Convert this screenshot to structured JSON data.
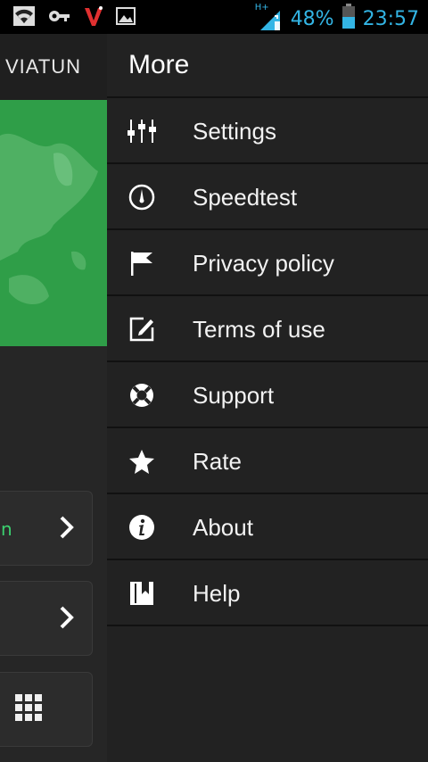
{
  "status_bar": {
    "battery": "48%",
    "time": "23:57",
    "network": "H+",
    "icons": [
      "wifi-icon",
      "key-icon",
      "viatun-v-icon",
      "image-icon",
      "signal-icon",
      "battery-icon"
    ]
  },
  "background_app": {
    "logo": "VIATUN",
    "card_1_text": "n"
  },
  "drawer": {
    "title": "More",
    "items": [
      {
        "label": "Settings",
        "icon": "sliders-icon"
      },
      {
        "label": "Speedtest",
        "icon": "speedometer-icon"
      },
      {
        "label": "Privacy policy",
        "icon": "flag-icon"
      },
      {
        "label": "Terms of use",
        "icon": "edit-icon"
      },
      {
        "label": "Support",
        "icon": "lifebuoy-icon"
      },
      {
        "label": "Rate",
        "icon": "star-icon"
      },
      {
        "label": "About",
        "icon": "info-icon"
      },
      {
        "label": "Help",
        "icon": "book-icon"
      }
    ]
  },
  "colors": {
    "status_accent": "#33b5e5",
    "map_green": "#2f9e48",
    "drawer_bg": "#222222"
  }
}
